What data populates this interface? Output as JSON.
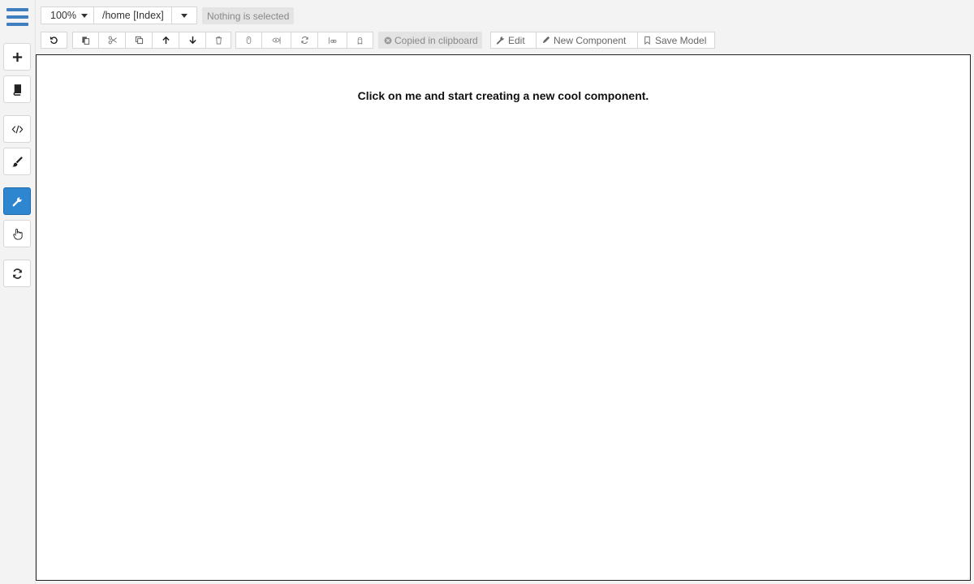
{
  "zoom": {
    "value": "100%"
  },
  "route": {
    "value": "/home [Index]"
  },
  "selection": {
    "status": "Nothing is selected"
  },
  "toolbar": {
    "clipboard_status": "Copied in clipboard",
    "edit_label": "Edit",
    "new_component_label": "New Component",
    "save_model_label": "Save Model"
  },
  "canvas": {
    "placeholder": "Click on me and start creating a new cool component."
  },
  "colors": {
    "accent": "#2f86d0",
    "menu": "#3f7fbf"
  }
}
